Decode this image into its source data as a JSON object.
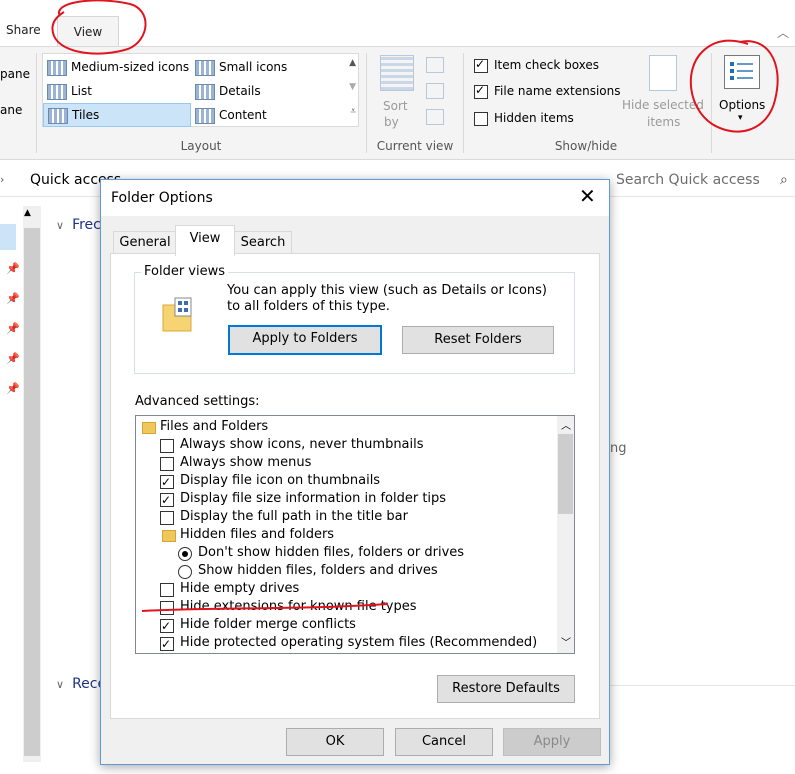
{
  "ribbon": {
    "tabs": [
      "Share",
      "View"
    ],
    "left_partial_labels": [
      "pane",
      "ane"
    ],
    "layout": {
      "items": [
        "Medium-sized icons",
        "Small icons",
        "List",
        "Details",
        "Tiles",
        "Content"
      ],
      "group_label": "Layout"
    },
    "current_view": {
      "sort_label": "Sort",
      "sort_by": "by",
      "group_label": "Current view"
    },
    "show_hide": {
      "item_check_boxes": "Item check boxes",
      "file_name_extensions": "File name extensions",
      "hidden_items": "Hidden items",
      "hide_selected": "Hide selected",
      "hide_selected_2": "items",
      "group_label": "Show/hide"
    },
    "options_label": "Options"
  },
  "navbar": {
    "location": "Quick access",
    "search_placeholder": "Search Quick access"
  },
  "background": {
    "section_frequent": "Frec",
    "section_recent": "Rece",
    "partial_text": "ng"
  },
  "dialog": {
    "title": "Folder Options",
    "tabs": [
      "General",
      "View",
      "Search"
    ],
    "folder_views": {
      "legend": "Folder views",
      "description": "You can apply this view (such as Details or Icons) to all folders of this type.",
      "apply_button": "Apply to Folders",
      "reset_button": "Reset Folders"
    },
    "advanced_label": "Advanced settings:",
    "tree": [
      {
        "kind": "folder",
        "label": "Files and Folders"
      },
      {
        "kind": "check",
        "checked": false,
        "label": "Always show icons, never thumbnails"
      },
      {
        "kind": "check",
        "checked": false,
        "label": "Always show menus"
      },
      {
        "kind": "check",
        "checked": true,
        "label": "Display file icon on thumbnails"
      },
      {
        "kind": "check",
        "checked": true,
        "label": "Display file size information in folder tips"
      },
      {
        "kind": "check",
        "checked": false,
        "label": "Display the full path in the title bar"
      },
      {
        "kind": "subfolder",
        "label": "Hidden files and folders"
      },
      {
        "kind": "radio",
        "checked": true,
        "label": "Don't show hidden files, folders or drives"
      },
      {
        "kind": "radio",
        "checked": false,
        "label": "Show hidden files, folders and drives"
      },
      {
        "kind": "check",
        "checked": false,
        "label": "Hide empty drives"
      },
      {
        "kind": "check",
        "checked": false,
        "label": "Hide extensions for known file types"
      },
      {
        "kind": "check",
        "checked": true,
        "label": "Hide folder merge conflicts"
      },
      {
        "kind": "check",
        "checked": true,
        "label": "Hide protected operating system files (Recommended)"
      }
    ],
    "restore_defaults": "Restore Defaults",
    "ok": "OK",
    "cancel": "Cancel",
    "apply": "Apply"
  },
  "colors": {
    "annotation": "#e0141e",
    "accent": "#0078d7"
  }
}
